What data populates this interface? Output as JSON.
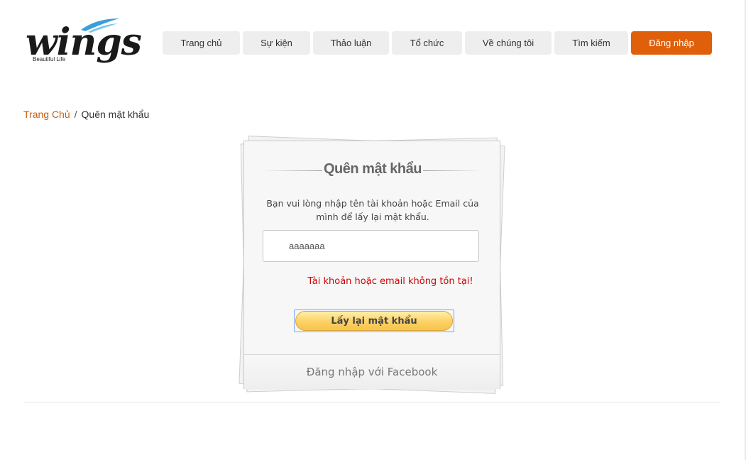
{
  "logo": {
    "wordmark": "wings",
    "tagline": "Beautiful Life"
  },
  "nav": {
    "items": [
      {
        "label": "Trang chủ"
      },
      {
        "label": "Sự kiện"
      },
      {
        "label": "Thảo luận"
      },
      {
        "label": "Tổ chức"
      },
      {
        "label": "Về chúng tôi"
      },
      {
        "label": "Tìm kiếm"
      },
      {
        "label": "Đăng nhập"
      }
    ],
    "active_label": "Đăng nhập"
  },
  "breadcrumb": {
    "home": "Trang Chủ",
    "separator": "/",
    "current": "Quên mật khẩu"
  },
  "form": {
    "title": "Quên mật khẩu",
    "description": "Bạn vui lòng nhập tên tài khoản hoặc Email của mình để lấy lại mật khẩu.",
    "input_value": "aaaaaaa",
    "error": "Tài khoản hoặc email không tồn tại!",
    "submit_label": "Lấy lại mật khẩu",
    "facebook_label": "Đăng nhập với Facebook"
  },
  "colors": {
    "accent": "#e05f0a",
    "breadcrumb_link": "#c95c10",
    "error": "#d40000",
    "button_gold": "#fdd36a"
  }
}
